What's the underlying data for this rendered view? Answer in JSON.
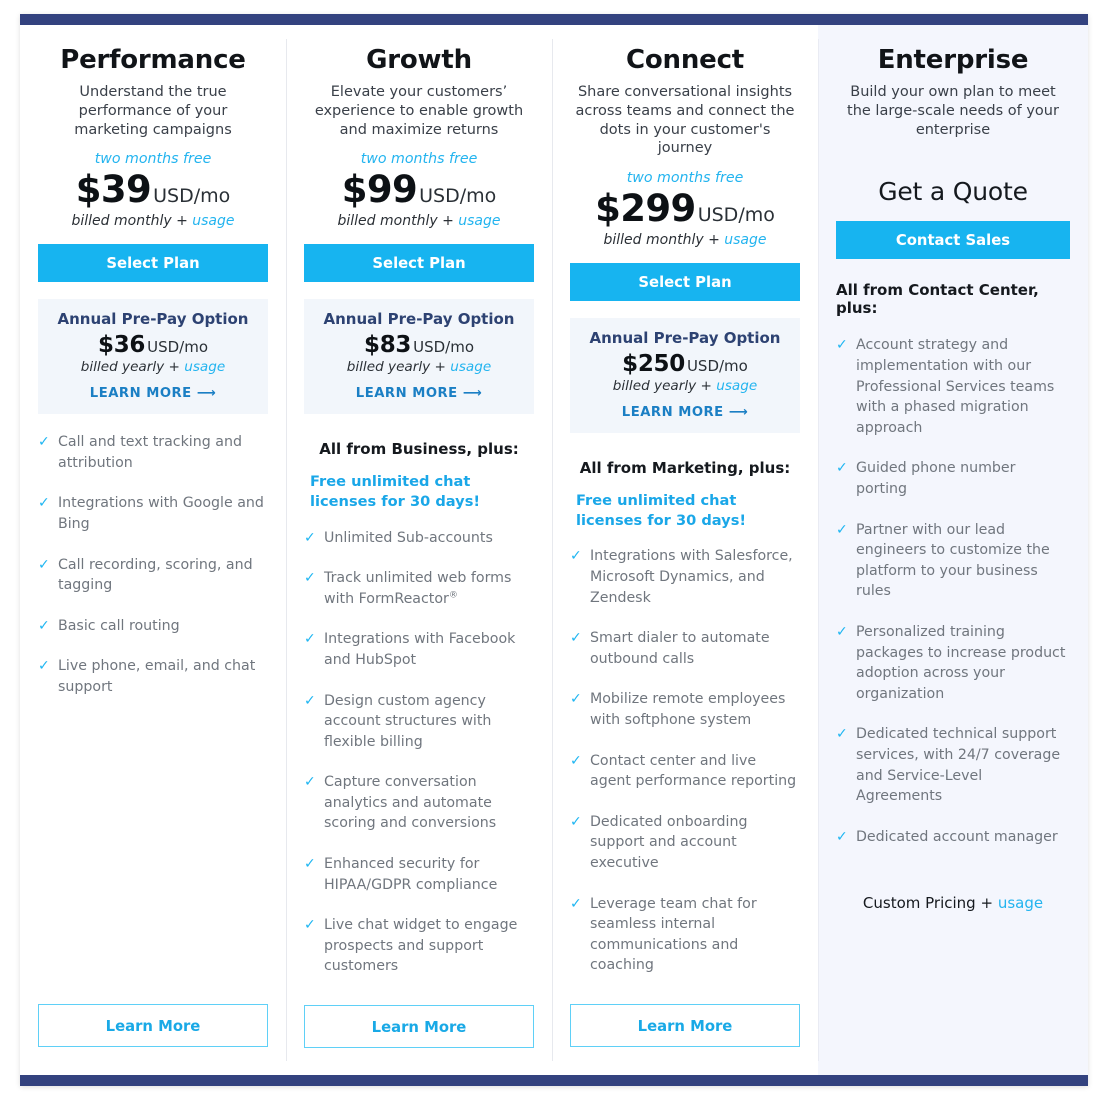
{
  "theme": {
    "bar_color": "#33427f",
    "primary_blue": "#17b4f0",
    "link_blue": "#23b4ef",
    "navy": "#2d4272",
    "feature_text": "#70767e",
    "enterprise_bg": "#f4f6fd",
    "prepay_bg": "#f2f6fb"
  },
  "plans": [
    {
      "name": "Performance",
      "description": "Understand the true performance of your marketing campaigns",
      "promo_note": "two months free",
      "price": "$39",
      "price_unit": "USD/mo",
      "billed": "billed monthly + ",
      "billed_link": "usage",
      "cta": "Select Plan",
      "prepay": {
        "title": "Annual Pre-Pay Option",
        "price": "$36",
        "price_unit": "USD/mo",
        "billed": "billed yearly + ",
        "billed_link": "usage",
        "link": "LEARN MORE ⟶"
      },
      "section_head": "",
      "promo_line": "",
      "features": [
        "Call and text tracking and attribution",
        "Integrations with Google and Bing",
        "Call recording, scoring, and tagging",
        "Basic call routing",
        "Live phone, email, and chat support"
      ],
      "footer_button": "Learn More"
    },
    {
      "name": "Growth",
      "description": "Elevate your customers’ experience to enable growth and maximize returns",
      "promo_note": "two months free",
      "price": "$99",
      "price_unit": "USD/mo",
      "billed": "billed monthly + ",
      "billed_link": "usage",
      "cta": "Select Plan",
      "prepay": {
        "title": "Annual Pre-Pay Option",
        "price": "$83",
        "price_unit": "USD/mo",
        "billed": "billed yearly + ",
        "billed_link": "usage",
        "link": "LEARN MORE ⟶"
      },
      "section_head": "All from Business, plus:",
      "promo_line": "Free unlimited chat licenses for 30 days!",
      "features": [
        "Unlimited Sub-accounts",
        "Track unlimited web forms with FormReactor®",
        "Integrations with Facebook and HubSpot",
        "Design custom agency account structures with flexible billing",
        "Capture conversation analytics and automate scoring and conversions",
        "Enhanced security for HIPAA/GDPR compliance",
        "Live chat widget to engage prospects and support customers"
      ],
      "footer_button": "Learn More"
    },
    {
      "name": "Connect",
      "description": "Share conversational insights across teams and connect the dots in your customer's journey",
      "promo_note": "two months free",
      "price": "$299",
      "price_unit": "USD/mo",
      "billed": "billed monthly + ",
      "billed_link": "usage",
      "cta": "Select Plan",
      "prepay": {
        "title": "Annual Pre-Pay Option",
        "price": "$250",
        "price_unit": "USD/mo",
        "billed": "billed yearly + ",
        "billed_link": "usage",
        "link": "LEARN MORE ⟶"
      },
      "section_head": "All from Marketing, plus:",
      "promo_line": "Free unlimited chat licenses for 30 days!",
      "features": [
        "Integrations with Salesforce, Microsoft Dynamics, and Zendesk",
        "Smart dialer to automate outbound calls",
        "Mobilize remote employees with softphone system",
        "Contact center and live agent performance reporting",
        "Dedicated onboarding support and account executive",
        "Leverage team chat for seamless internal communications and coaching"
      ],
      "footer_button": "Learn More"
    }
  ],
  "enterprise": {
    "name": "Enterprise",
    "description": "Build your own plan to meet the large-scale needs of your enterprise",
    "quote_head": "Get a Quote",
    "cta": "Contact Sales",
    "section_head": "All from Contact Center, plus:",
    "features": [
      "Account strategy and implementation with our Professional Services teams with a phased migration approach",
      "Guided phone number porting",
      "Partner with our lead engineers to customize the platform to your business rules",
      "Personalized training packages to increase product adoption across your organization",
      "Dedicated technical support services, with 24/7 coverage and Service-Level Agreements",
      "Dedicated account manager"
    ],
    "custom_pricing": "Custom Pricing + ",
    "custom_pricing_link": "usage"
  },
  "icons": {
    "check": "✓"
  }
}
